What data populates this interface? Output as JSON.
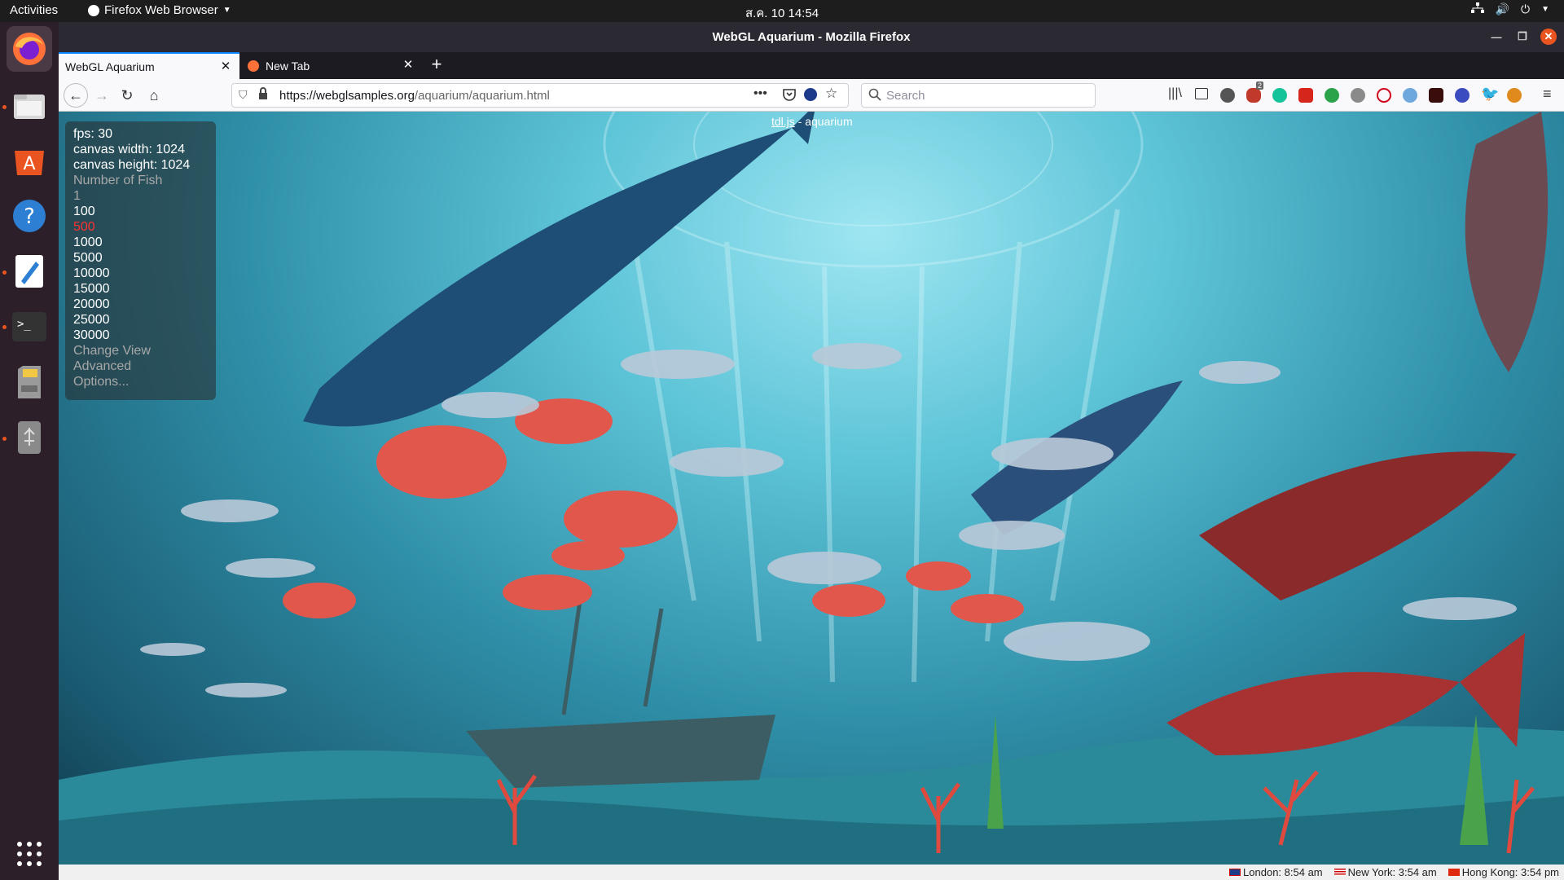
{
  "topbar": {
    "activities": "Activities",
    "app_menu": "Firefox Web Browser",
    "clock": "ส.ค. 10  14:54"
  },
  "window": {
    "title": "WebGL Aquarium - Mozilla Firefox"
  },
  "tabs": [
    {
      "label": "WebGL Aquarium",
      "active": true
    },
    {
      "label": "New Tab",
      "active": false
    }
  ],
  "navbar": {
    "url_domain": "https://webglsamples.org",
    "url_path": "/aquarium/aquarium.html",
    "search_placeholder": "Search",
    "ublock_badge": "2"
  },
  "page": {
    "header_link": "tdl.js",
    "header_rest": " - aquarium",
    "fps": "fps: 30",
    "canvas_width": "canvas width: 1024",
    "canvas_height": "canvas height: 1024",
    "fish_heading": "Number of Fish",
    "fish_options": [
      "1",
      "100",
      "500",
      "1000",
      "5000",
      "10000",
      "15000",
      "20000",
      "25000",
      "30000"
    ],
    "selected_fish": "500",
    "change_view": "Change View",
    "advanced": "Advanced",
    "options": "Options..."
  },
  "statusbar": {
    "london": "London: 8:54 am",
    "newyork": "New York: 3:54 am",
    "hongkong": "Hong Kong: 3:54 pm"
  },
  "colors": {
    "accent": "#0a84ff",
    "ubuntu_orange": "#e95420",
    "selected_option": "#ff3030"
  }
}
